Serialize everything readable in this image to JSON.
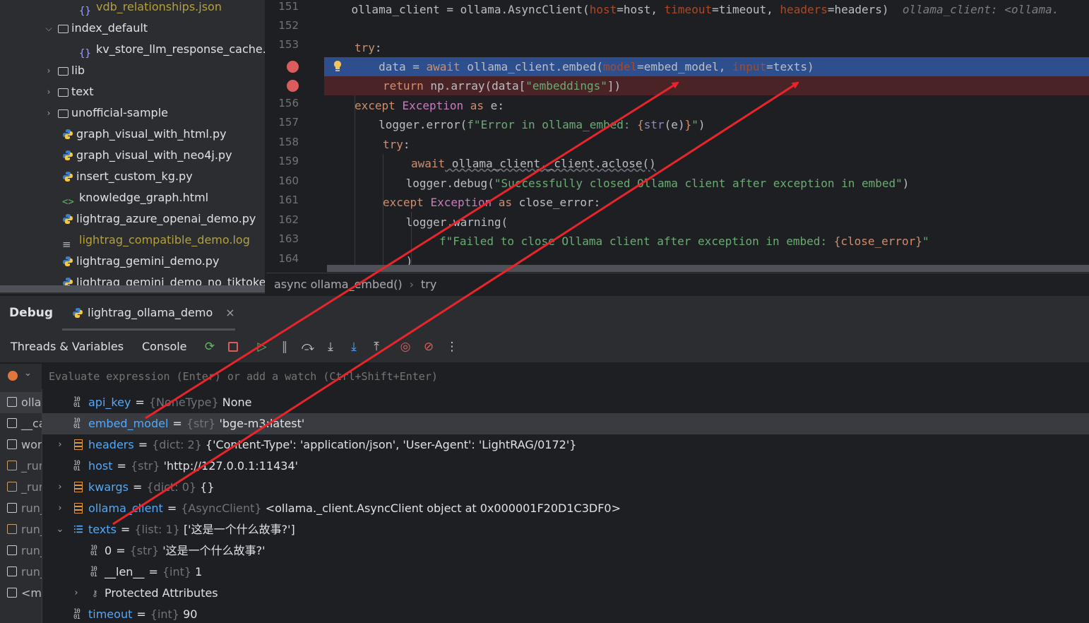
{
  "project_tree": {
    "items": [
      {
        "label": "vdb_relationships.json",
        "icon": "json-icon",
        "color": "#b5a03e"
      },
      {
        "label": "index_default",
        "icon": "folder-icon",
        "expanded": true
      },
      {
        "label": "kv_store_llm_response_cache.js",
        "icon": "json-icon"
      },
      {
        "label": "lib",
        "icon": "folder-icon",
        "expanded": false
      },
      {
        "label": "text",
        "icon": "folder-icon",
        "expanded": false
      },
      {
        "label": "unofficial-sample",
        "icon": "folder-icon",
        "expanded": false
      },
      {
        "label": "graph_visual_with_html.py",
        "icon": "python-icon"
      },
      {
        "label": "graph_visual_with_neo4j.py",
        "icon": "python-icon"
      },
      {
        "label": "insert_custom_kg.py",
        "icon": "python-icon"
      },
      {
        "label": "knowledge_graph.html",
        "icon": "html-icon"
      },
      {
        "label": "lightrag_azure_openai_demo.py",
        "icon": "python-icon"
      },
      {
        "label": "lightrag_compatible_demo.log",
        "icon": "log-icon",
        "color": "#b5a03e"
      },
      {
        "label": "lightrag_gemini_demo.py",
        "icon": "python-icon"
      },
      {
        "label": "lightrag_gemini_demo_no_tiktoken",
        "icon": "python-icon"
      }
    ]
  },
  "editor": {
    "line_numbers": [
      "151",
      "152",
      "153",
      "",
      "",
      "156",
      "157",
      "158",
      "159",
      "160",
      "161",
      "162",
      "163",
      "164"
    ],
    "lines": {
      "l151_a": "    ollama_client = ollama.AsyncClient(",
      "l151_host_kw": "host",
      "l151_b": "=host, ",
      "l151_timeout_kw": "timeout",
      "l151_c": "=timeout, ",
      "l151_headers_kw": "headers",
      "l151_d": "=headers)",
      "l151_hint": "ollama_client: <ollama.",
      "l153_try": "try",
      "l153_colon": ":",
      "l154_a": "        data = ",
      "l154_await": "await",
      "l154_b": " ollama_client.embed(",
      "l154_model": "model",
      "l154_c": "=embed_model, ",
      "l154_input": "input",
      "l154_d": "=texts)",
      "l155_return": "return",
      "l155_a": " np.array(data[",
      "l155_str": "\"embeddings\"",
      "l155_b": "])",
      "l156_except": "except",
      "l156_exc": "Exception",
      "l156_as": "as",
      "l156_b": " e:",
      "l157_a": "        logger.error(",
      "l157_str_a": "f\"Error in ollama_embed: ",
      "l157_brace_a": "{",
      "l157_str_fn": "str",
      "l157_mid": "(e)",
      "l157_brace_b": "}",
      "l157_str_b": "\"",
      "l157_end": ")",
      "l158_try": "try",
      "l158_colon": ":",
      "l159_await": "await",
      "l159_a": " ollama_client._client.aclose()",
      "l160_a": "            logger.debug(",
      "l160_str": "\"Successfully closed Ollama client after exception in embed\"",
      "l160_end": ")",
      "l161_except": "except",
      "l161_exc": "Exception",
      "l161_as": "as",
      "l161_b": " close_error:",
      "l162_a": "            logger.warning(",
      "l163_str_a": "f\"Failed to close Ollama client after exception in embed: ",
      "l163_var": "{close_error}",
      "l163_str_b": "\"",
      "l164_a": "            )"
    }
  },
  "breadcrumb": {
    "items": [
      "async ollama_embed()",
      "try"
    ],
    "separator": "›"
  },
  "debug": {
    "title": "Debug",
    "session_tab": "lightrag_ollama_demo",
    "close": "×",
    "toolbar_tabs": [
      "Threads & Variables",
      "Console"
    ],
    "eval_placeholder": "Evaluate expression (Enter) or add a watch (Ctrl+Shift+Enter)"
  },
  "frames": [
    {
      "label": "olla",
      "selected": true
    },
    {
      "label": "__ca"
    },
    {
      "label": "wor"
    },
    {
      "label": "_rur",
      "lib": true
    },
    {
      "label": "_rur",
      "lib": true
    },
    {
      "label": "run_"
    },
    {
      "label": "run_",
      "lib": true
    },
    {
      "label": "run_"
    },
    {
      "label": "run_"
    },
    {
      "label": "<m"
    }
  ],
  "variables": [
    {
      "name": "api_key",
      "type": "{NoneType}",
      "value": "None"
    },
    {
      "name": "embed_model",
      "type": "{str}",
      "value": "'bge-m3:latest'",
      "selected": true
    },
    {
      "name": "headers",
      "type": "{dict: 2}",
      "value": "{'Content-Type': 'application/json', 'User-Agent': 'LightRAG/0172'}",
      "expandable": true
    },
    {
      "name": "host",
      "type": "{str}",
      "value": "'http://127.0.0.1:11434'"
    },
    {
      "name": "kwargs",
      "type": "{dict: 0}",
      "value": "{}",
      "expandable": true
    },
    {
      "name": "ollama_client",
      "type": "{AsyncClient}",
      "value": "<ollama._client.AsyncClient object at 0x000001F20D1C3DF0>",
      "expandable": true
    },
    {
      "name": "texts",
      "type": "{list: 1}",
      "value": "['这是一个什么故事?']",
      "expanded": true
    },
    {
      "name": "0",
      "type": "{str}",
      "value": "'这是一个什么故事?'",
      "child": true
    },
    {
      "name": "__len__",
      "type": "{int}",
      "value": "1",
      "child": true
    },
    {
      "name": "Protected Attributes",
      "child": true,
      "expandable": true
    },
    {
      "name": "timeout",
      "type": "{int}",
      "value": "90"
    }
  ],
  "colors": {
    "accent_blue": "#56a8f5",
    "exec_line": "#2d4f8d",
    "breakpoint": "#db5c5c",
    "annotation_arrow": "#e8252b"
  }
}
